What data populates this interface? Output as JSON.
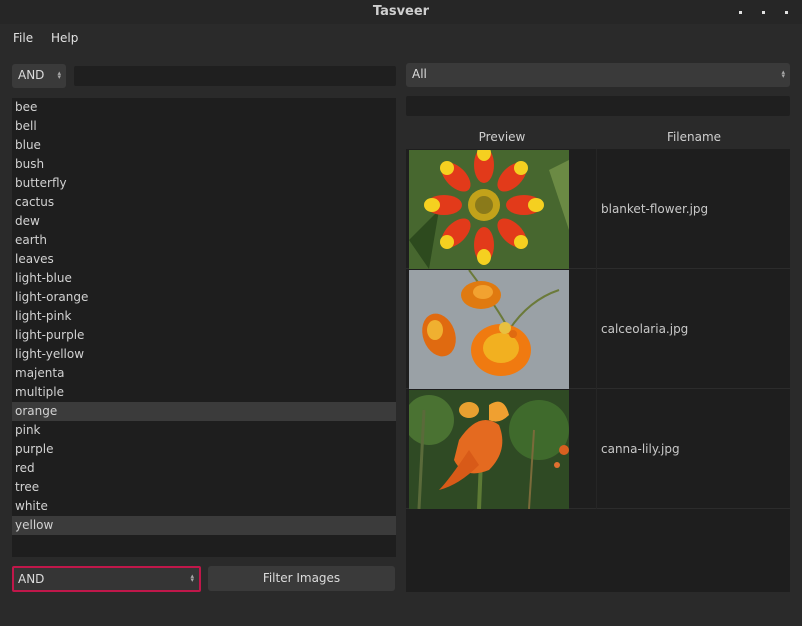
{
  "window": {
    "title": "Tasveer"
  },
  "menu": {
    "file": "File",
    "help": "Help"
  },
  "left": {
    "mode_top": "AND",
    "search_value": "",
    "tags": [
      "bee",
      "bell",
      "blue",
      "bush",
      "butterfly",
      "cactus",
      "dew",
      "earth",
      "leaves",
      "light-blue",
      "light-orange",
      "light-pink",
      "light-purple",
      "light-yellow",
      "majenta",
      "multiple",
      "orange",
      "pink",
      "purple",
      "red",
      "tree",
      "white",
      "yellow"
    ],
    "selected_tags": [
      "orange",
      "yellow"
    ],
    "mode_bottom": "AND",
    "filter_button": "Filter Images"
  },
  "right": {
    "folder_select": "All",
    "path_value": "",
    "columns": {
      "preview": "Preview",
      "filename": "Filename"
    },
    "files": [
      {
        "filename": "blanket-flower.jpg",
        "thumb": "blanket-flower-image"
      },
      {
        "filename": "calceolaria.jpg",
        "thumb": "calceolaria-image"
      },
      {
        "filename": "canna-lily.jpg",
        "thumb": "canna-lily-image"
      }
    ]
  },
  "colors": {
    "accent_border": "#c0174a",
    "selection": "#3b3b3b",
    "background": "#2a2a2a"
  }
}
